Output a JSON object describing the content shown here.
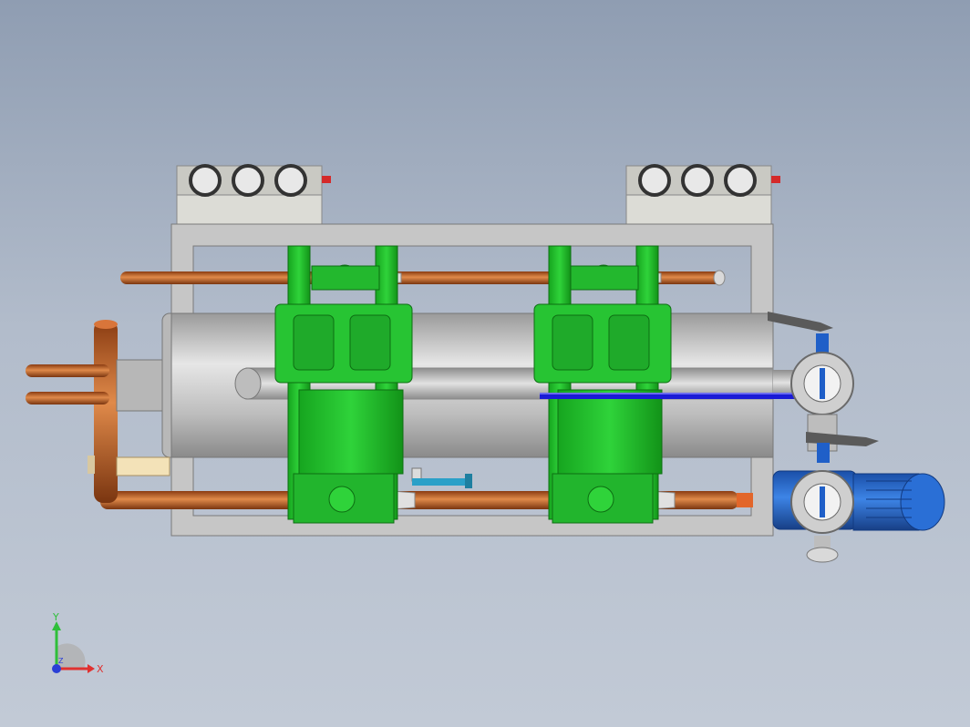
{
  "viewport": {
    "background_top": "#8f9db2",
    "background_bottom": "#c2cad6"
  },
  "model": {
    "frame_color": "#c4c4c4",
    "compressor_color": "#1fbf2a",
    "pipe_color": "#c0622a",
    "motor_color": "#1f5fc8",
    "shell_color": "#c9c9c9",
    "marker_color": "#1a1ad6"
  },
  "triad": {
    "x_label": "X",
    "y_label": "Y",
    "z_label": "Z",
    "x_color": "#e0312f",
    "y_color": "#2fbf3a",
    "z_color": "#2a3fd6"
  }
}
